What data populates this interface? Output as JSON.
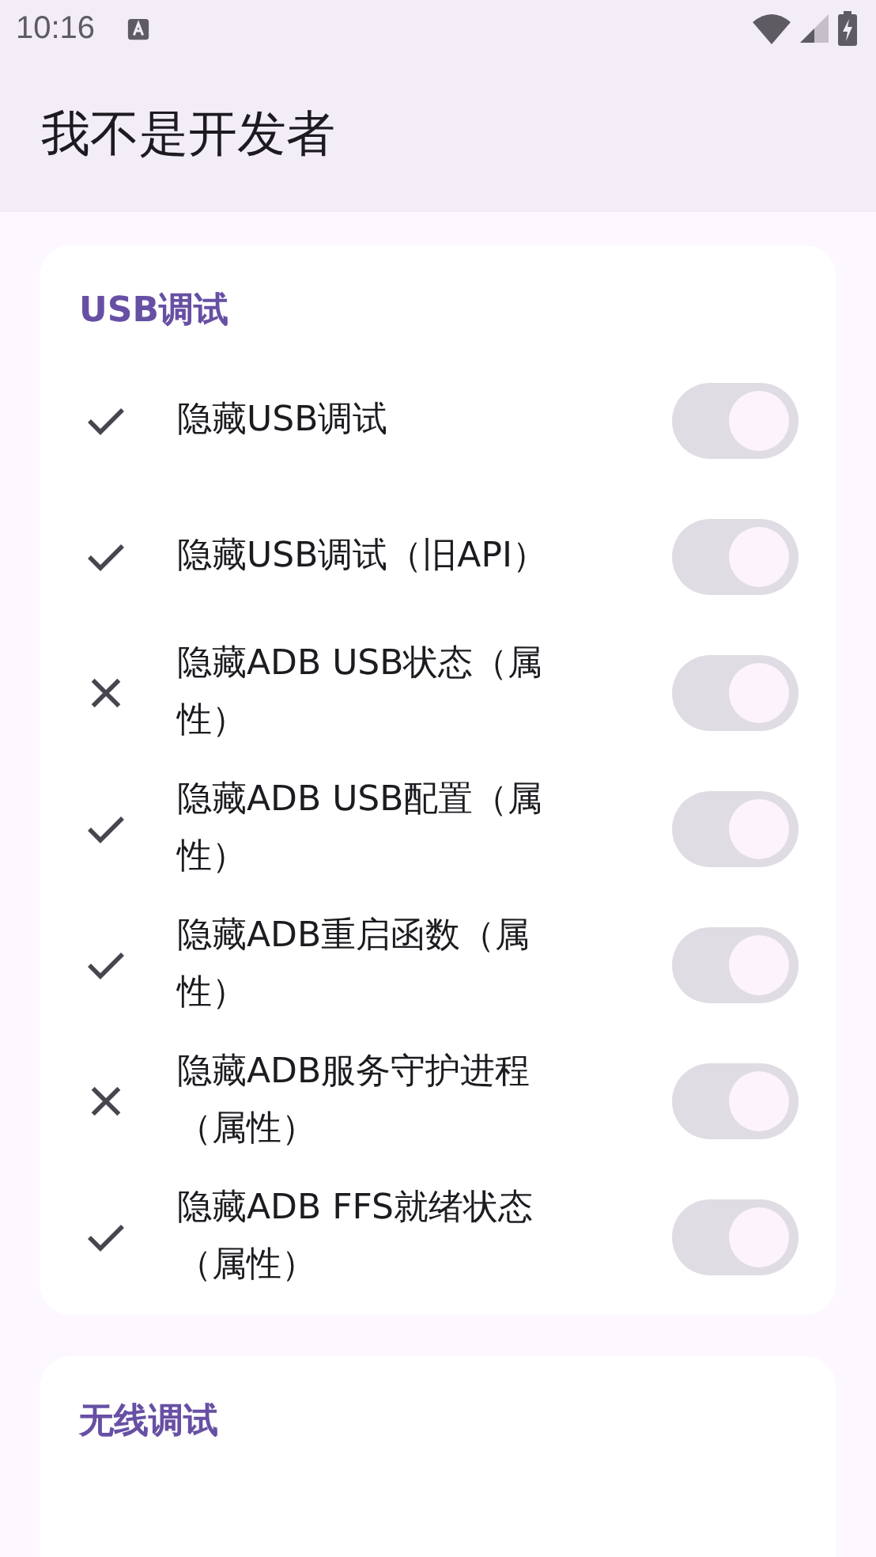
{
  "status_bar": {
    "time": "10:16"
  },
  "app_bar": {
    "title": "我不是开发者"
  },
  "sections": [
    {
      "title": "USB调试",
      "items": [
        {
          "label": "隐藏USB调试",
          "kind": "ok",
          "on": true,
          "disabled": true
        },
        {
          "label": "隐藏USB调试（旧API）",
          "kind": "ok",
          "on": true,
          "disabled": true
        },
        {
          "label": "隐藏ADB USB状态（属性）",
          "kind": "fail",
          "on": true,
          "disabled": true
        },
        {
          "label": "隐藏ADB USB配置（属性）",
          "kind": "ok",
          "on": true,
          "disabled": true
        },
        {
          "label": "隐藏ADB重启函数（属性）",
          "kind": "ok",
          "on": true,
          "disabled": true
        },
        {
          "label": "隐藏ADB服务守护进程（属性）",
          "kind": "fail",
          "on": true,
          "disabled": true
        },
        {
          "label": "隐藏ADB FFS就绪状态（属性）",
          "kind": "ok",
          "on": true,
          "disabled": true
        }
      ]
    },
    {
      "title": "无线调试"
    }
  ]
}
